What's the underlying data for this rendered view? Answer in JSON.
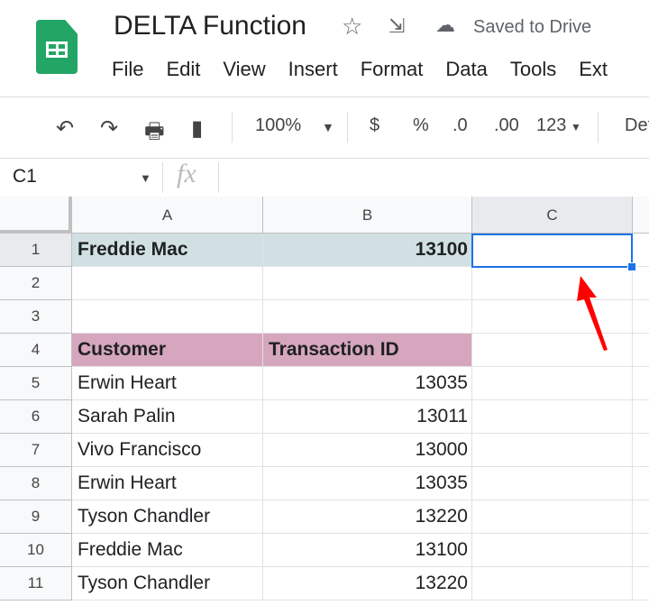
{
  "doc": {
    "title": "DELTA Function",
    "save_status": "Saved to Drive"
  },
  "menu": [
    "File",
    "Edit",
    "View",
    "Insert",
    "Format",
    "Data",
    "Tools",
    "Ext"
  ],
  "toolbar": {
    "zoom": "100%",
    "currency": "$",
    "percent": "%",
    "dec_decrease": ".0",
    "dec_increase": ".00",
    "more_formats": "123",
    "font": "Def"
  },
  "formula_bar": {
    "name_box": "C1",
    "fx": "fx",
    "value": ""
  },
  "columns": [
    "A",
    "B",
    "C"
  ],
  "rows": [
    {
      "n": "1",
      "a": "Freddie Mac",
      "b": "13100"
    },
    {
      "n": "2",
      "a": "",
      "b": ""
    },
    {
      "n": "3",
      "a": "",
      "b": ""
    },
    {
      "n": "4",
      "a": "Customer",
      "b": "Transaction ID"
    },
    {
      "n": "5",
      "a": "Erwin Heart",
      "b": "13035"
    },
    {
      "n": "6",
      "a": "Sarah Palin",
      "b": "13011"
    },
    {
      "n": "7",
      "a": "Vivo Francisco",
      "b": "13000"
    },
    {
      "n": "8",
      "a": "Erwin Heart",
      "b": "13035"
    },
    {
      "n": "9",
      "a": "Tyson Chandler",
      "b": "13220"
    },
    {
      "n": "10",
      "a": "Freddie Mac",
      "b": "13100"
    },
    {
      "n": "11",
      "a": "Tyson Chandler",
      "b": "13220"
    }
  ],
  "colors": {
    "row1_fill": "#d0e0e3",
    "header_fill": "#d5a6bd",
    "selection": "#1a73e8",
    "arrow": "#ff0000"
  }
}
